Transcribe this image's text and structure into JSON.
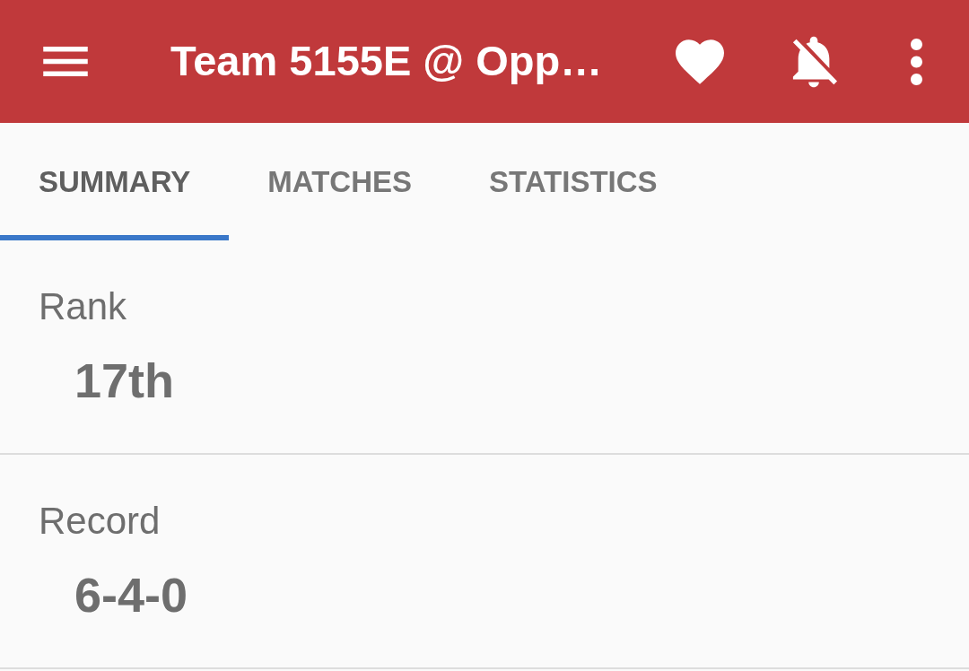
{
  "app_bar": {
    "title": "Team 5155E @ Opp…",
    "favorited": true,
    "notifications_on": false
  },
  "tabs": [
    {
      "label": "SUMMARY",
      "selected": true
    },
    {
      "label": "MATCHES",
      "selected": false
    },
    {
      "label": "STATISTICS",
      "selected": false
    }
  ],
  "summary": [
    {
      "label": "Rank",
      "value": "17th"
    },
    {
      "label": "Record",
      "value": "6-4-0"
    }
  ]
}
